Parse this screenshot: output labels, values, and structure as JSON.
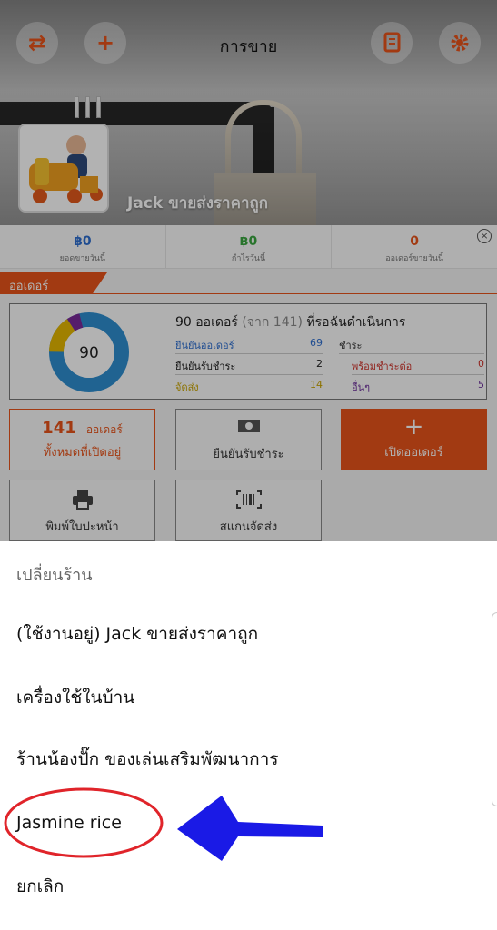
{
  "header": {
    "title": "การขาย",
    "shop_name": "Jack ขายส่งราคาถูก"
  },
  "stats": [
    {
      "value": "฿0",
      "label": "ยอดขายวันนี้",
      "color": "#2f6fd0"
    },
    {
      "value": "฿0",
      "label": "กำไรวันนี้",
      "color": "#3aa640"
    },
    {
      "value": "0",
      "label": "ออเดอร์ขายวันนี้",
      "color": "#e8541a"
    }
  ],
  "orders": {
    "tab_label": "ออเดอร์",
    "summary_count": "90 ออเดอร์",
    "summary_total": "(จาก 141)",
    "summary_suffix": "ที่รอฉันดำเนินการ",
    "donut_center": "90",
    "rows_left": [
      {
        "label": "ยืนยันออเดอร์",
        "value": "69",
        "color": "#2f6fd0"
      },
      {
        "label": "ยืนยันรับชำระ",
        "value": "2",
        "color": "#222222"
      },
      {
        "label": "จัดส่ง",
        "value": "14",
        "color": "#c9a400"
      }
    ],
    "right_header": "ชำระ",
    "rows_right": [
      {
        "label": "พร้อมชำระต่อ",
        "value": "0",
        "color": "#d0342c"
      },
      {
        "label": "อื่นๆ",
        "value": "5",
        "color": "#6a2a9a"
      }
    ]
  },
  "tiles": {
    "open_count": "141",
    "open_unit": "ออเดอร์",
    "open_label": "ทั้งหมดที่เปิดอยู่",
    "confirm_payment": "ยืนยันรับชำระ",
    "new_order": "เปิดออเดอร์",
    "print_label": "พิมพ์ใบปะหน้า",
    "scan_label": "สแกนจัดส่ง"
  },
  "sheet": {
    "header": "เปลี่ยนร้าน",
    "options": [
      "(ใช้งานอยู่) Jack ขายส่งราคาถูก",
      "เครื่องใช้ในบ้าน",
      "ร้านน้องปั๊ก ของเล่นเสริมพัฒนาการ",
      "Jasmine rice",
      "ยกเลิก"
    ]
  },
  "colors": {
    "accent": "#e8541a",
    "annotation_circle": "#e0242a",
    "annotation_arrow": "#1a1ae6"
  },
  "icons": [
    "swap-icon",
    "plus-icon",
    "book-icon",
    "gear-icon",
    "money-icon",
    "printer-icon",
    "barcode-icon",
    "close-icon"
  ]
}
